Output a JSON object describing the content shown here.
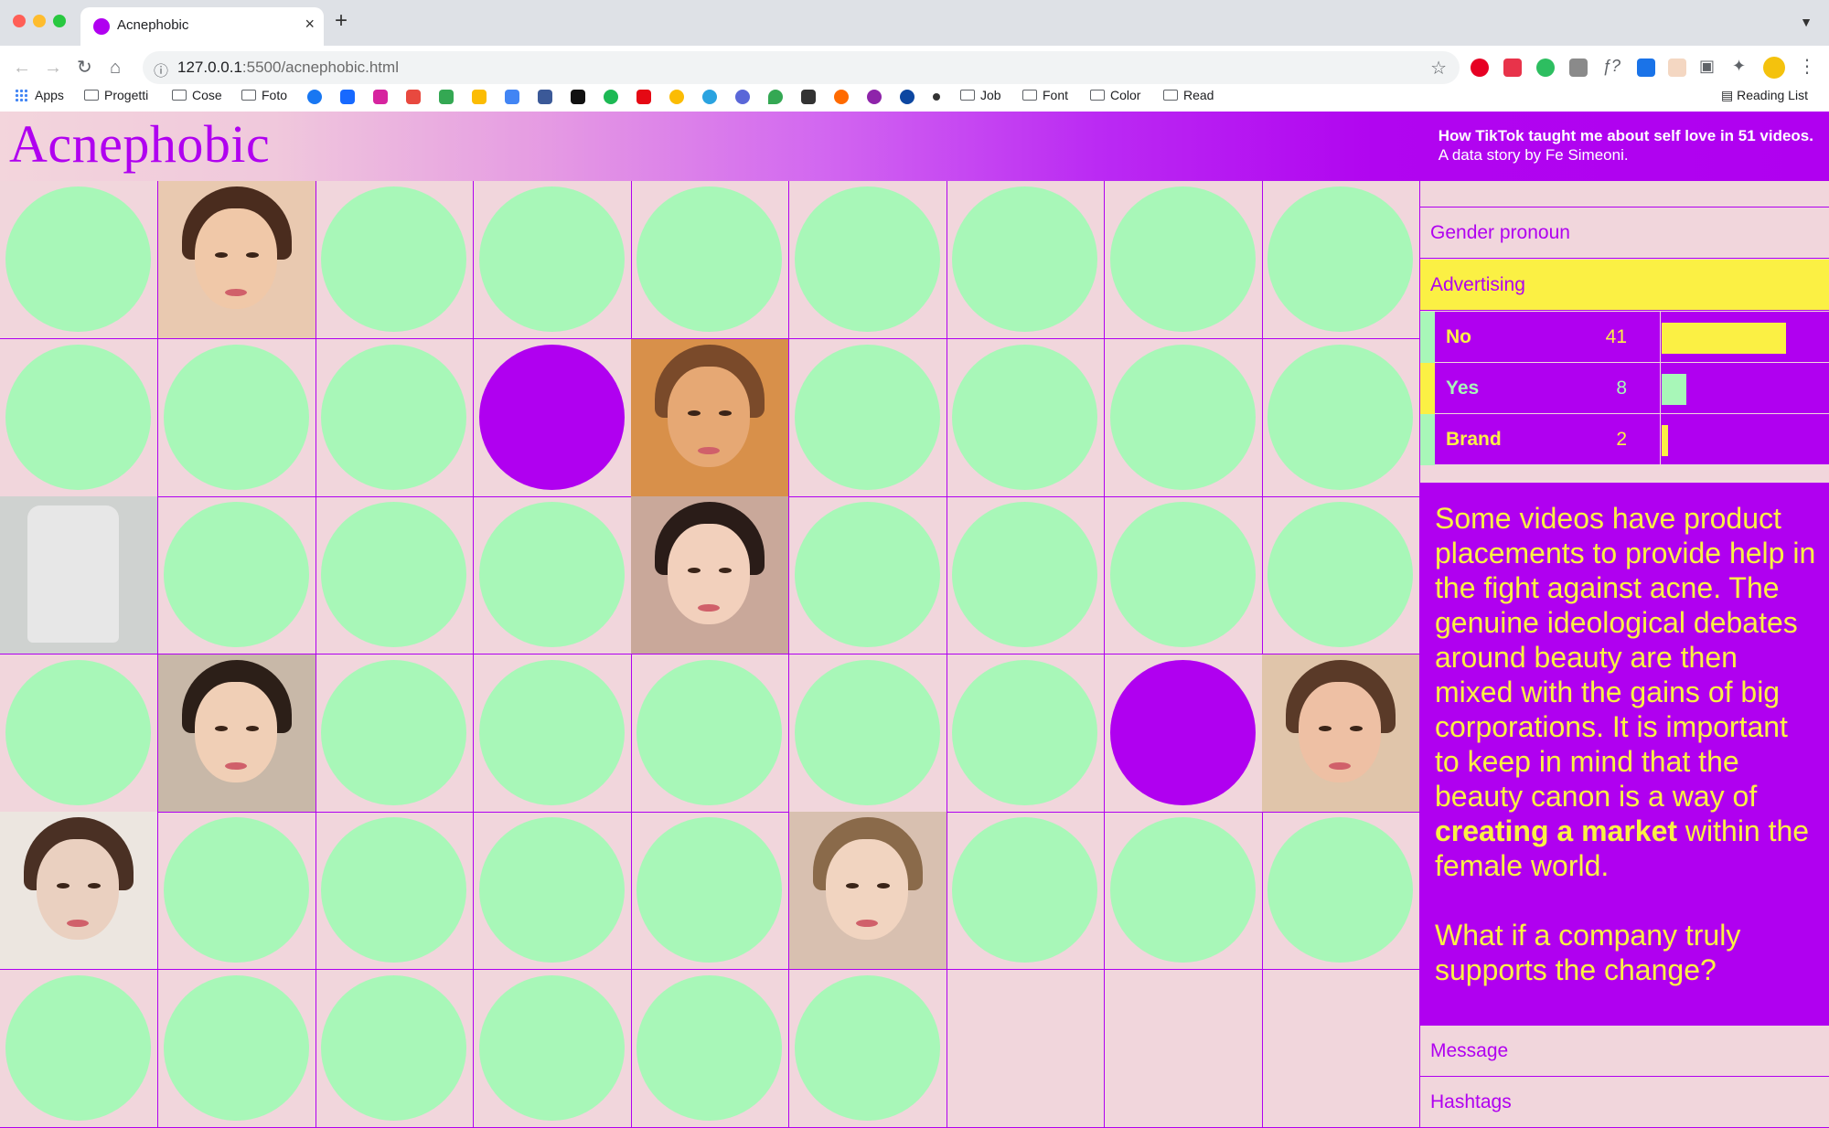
{
  "browser": {
    "tab_title": "Acnephobic",
    "url_host": "127.0.0.1",
    "url_path": ":5500/acnephobic.html",
    "bookmarks": [
      "Apps",
      "Progetti",
      "Cose",
      "Foto",
      "Job",
      "Font",
      "Color",
      "Read"
    ],
    "reading_list": "Reading List"
  },
  "header": {
    "logo": "Acnephobic",
    "tagline_1": "How TikTok taught me about self love in 51 videos.",
    "tagline_2": "A data story by Fe Simeoni."
  },
  "colors": {
    "purple": "#b000f0",
    "mint": "#a8f7b8",
    "yellow": "#fbf044",
    "pink": "#f1d6dc"
  },
  "grid": {
    "columns": 9,
    "cells": [
      "circle",
      "photo",
      "circle",
      "circle",
      "circle",
      "circle",
      "circle",
      "circle",
      "circle",
      "circle",
      "circle",
      "circle",
      "purple",
      "photo",
      "circle",
      "circle",
      "circle",
      "circle",
      "photo",
      "circle",
      "circle",
      "circle",
      "photo",
      "circle",
      "circle",
      "circle",
      "circle",
      "circle",
      "photo",
      "circle",
      "circle",
      "circle",
      "circle",
      "circle",
      "purple",
      "photo",
      "photo",
      "circle",
      "circle",
      "circle",
      "circle",
      "photo",
      "circle",
      "circle",
      "circle",
      "circle",
      "circle",
      "circle",
      "circle",
      "circle",
      "circle",
      "empty",
      "empty",
      "empty"
    ]
  },
  "panel": {
    "sections": {
      "gender": "Gender pronoun",
      "advertising": "Advertising",
      "message": "Message",
      "hashtags": "Hashtags"
    },
    "stats": [
      {
        "label": "No",
        "count": "41",
        "value": 41,
        "color": "#fbf044"
      },
      {
        "label": "Yes",
        "count": "8",
        "value": 8,
        "color": "#a8f7b8"
      },
      {
        "label": "Brand",
        "count": "2",
        "value": 2,
        "color": "#fbf044"
      }
    ],
    "story": {
      "p1_a": "Some videos have product placements to provide help in the fight against acne. The genuine ideological debates around beauty are then mixed with the gains of big corporations. It is important to keep in mind that the beauty canon is a way of ",
      "p1_bold": "creating a market",
      "p1_b": " within the female world.",
      "p2": "What if a company truly supports the change?"
    }
  }
}
